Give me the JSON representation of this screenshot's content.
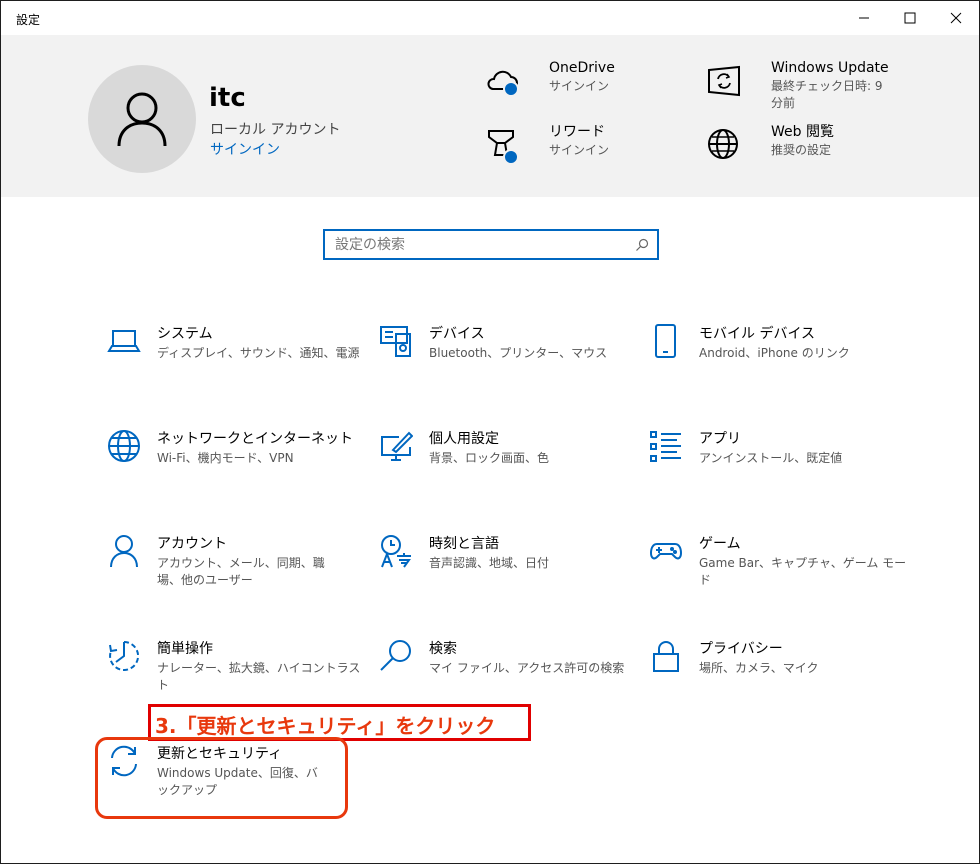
{
  "window": {
    "title": "設定"
  },
  "account": {
    "name": "itc",
    "type": "ローカル アカウント",
    "signin_link": "サインイン"
  },
  "header_items": [
    {
      "title": "OneDrive",
      "subtitle": "サインイン",
      "icon": "cloud-icon"
    },
    {
      "title": "Windows Update",
      "subtitle": "最終チェック日時: 9 分前",
      "icon": "windows-update-icon"
    },
    {
      "title": "リワード",
      "subtitle": "サインイン",
      "icon": "trophy-icon"
    },
    {
      "title": "Web 閲覧",
      "subtitle": "推奨の設定",
      "icon": "globe-icon"
    }
  ],
  "search": {
    "placeholder": "設定の検索"
  },
  "categories": [
    {
      "title": "システム",
      "subtitle": "ディスプレイ、サウンド、通知、電源",
      "icon": "laptop-icon"
    },
    {
      "title": "デバイス",
      "subtitle": "Bluetooth、プリンター、マウス",
      "icon": "devices-icon"
    },
    {
      "title": "モバイル デバイス",
      "subtitle": "Android、iPhone のリンク",
      "icon": "phone-icon"
    },
    {
      "title": "ネットワークとインターネット",
      "subtitle": "Wi-Fi、機内モード、VPN",
      "icon": "globe-icon"
    },
    {
      "title": "個人用設定",
      "subtitle": "背景、ロック画面、色",
      "icon": "paint-icon"
    },
    {
      "title": "アプリ",
      "subtitle": "アンインストール、既定値",
      "icon": "apps-list-icon"
    },
    {
      "title": "アカウント",
      "subtitle": "アカウント、メール、同期、職場、他のユーザー",
      "icon": "person-icon"
    },
    {
      "title": "時刻と言語",
      "subtitle": "音声認識、地域、日付",
      "icon": "time-language-icon"
    },
    {
      "title": "ゲーム",
      "subtitle": "Game Bar、キャプチャ、ゲーム モード",
      "icon": "gamepad-icon"
    },
    {
      "title": "簡単操作",
      "subtitle": "ナレーター、拡大鏡、ハイコントラスト",
      "icon": "ease-of-access-icon"
    },
    {
      "title": "検索",
      "subtitle": "マイ ファイル、アクセス許可の検索",
      "icon": "search-icon"
    },
    {
      "title": "プライバシー",
      "subtitle": "場所、カメラ、マイク",
      "icon": "lock-icon"
    },
    {
      "title": "更新とセキュリティ",
      "subtitle": "Windows Update、回復、バックアップ",
      "icon": "sync-icon"
    }
  ],
  "annotation": {
    "text": "3.「更新とセキュリティ」をクリック"
  },
  "colors": {
    "accent": "#0067c0",
    "annotation": "#e8380d",
    "header_bg": "#f2f2f2"
  }
}
